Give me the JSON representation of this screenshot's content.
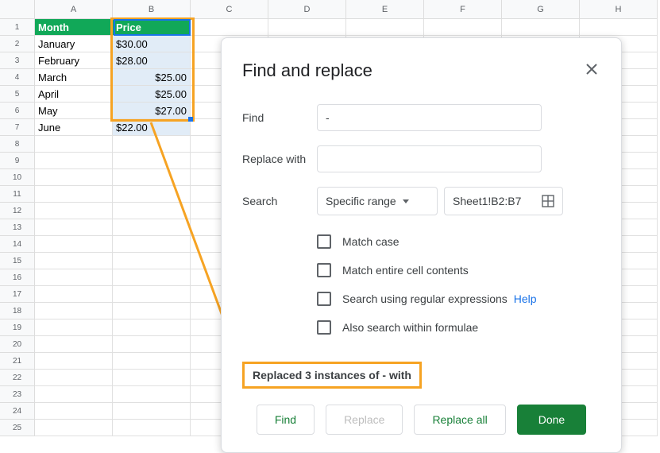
{
  "columns": [
    "A",
    "B",
    "C",
    "D",
    "E",
    "F",
    "G",
    "H"
  ],
  "rows_count": 25,
  "headers": {
    "month": "Month",
    "price": "Price"
  },
  "data": {
    "months": [
      "January",
      "February",
      "March",
      "April",
      "May",
      "June"
    ],
    "prices": [
      "$30.00",
      "$28.00",
      "$25.00",
      "$25.00",
      "$27.00",
      "$22.00"
    ]
  },
  "dialog": {
    "title": "Find and replace",
    "find_label": "Find",
    "find_value": "-",
    "replace_label": "Replace with",
    "replace_value": "",
    "search_label": "Search",
    "search_scope": "Specific range",
    "search_range": "Sheet1!B2:B7",
    "opt_match_case": "Match case",
    "opt_match_cell": "Match entire cell contents",
    "opt_regex": "Search using regular expressions",
    "opt_formulae": "Also search within formulae",
    "help_label": "Help",
    "status": "Replaced 3 instances of - with",
    "btn_find": "Find",
    "btn_replace": "Replace",
    "btn_replace_all": "Replace all",
    "btn_done": "Done"
  },
  "price_align": [
    "left",
    "left",
    "right",
    "right",
    "right",
    "left"
  ]
}
